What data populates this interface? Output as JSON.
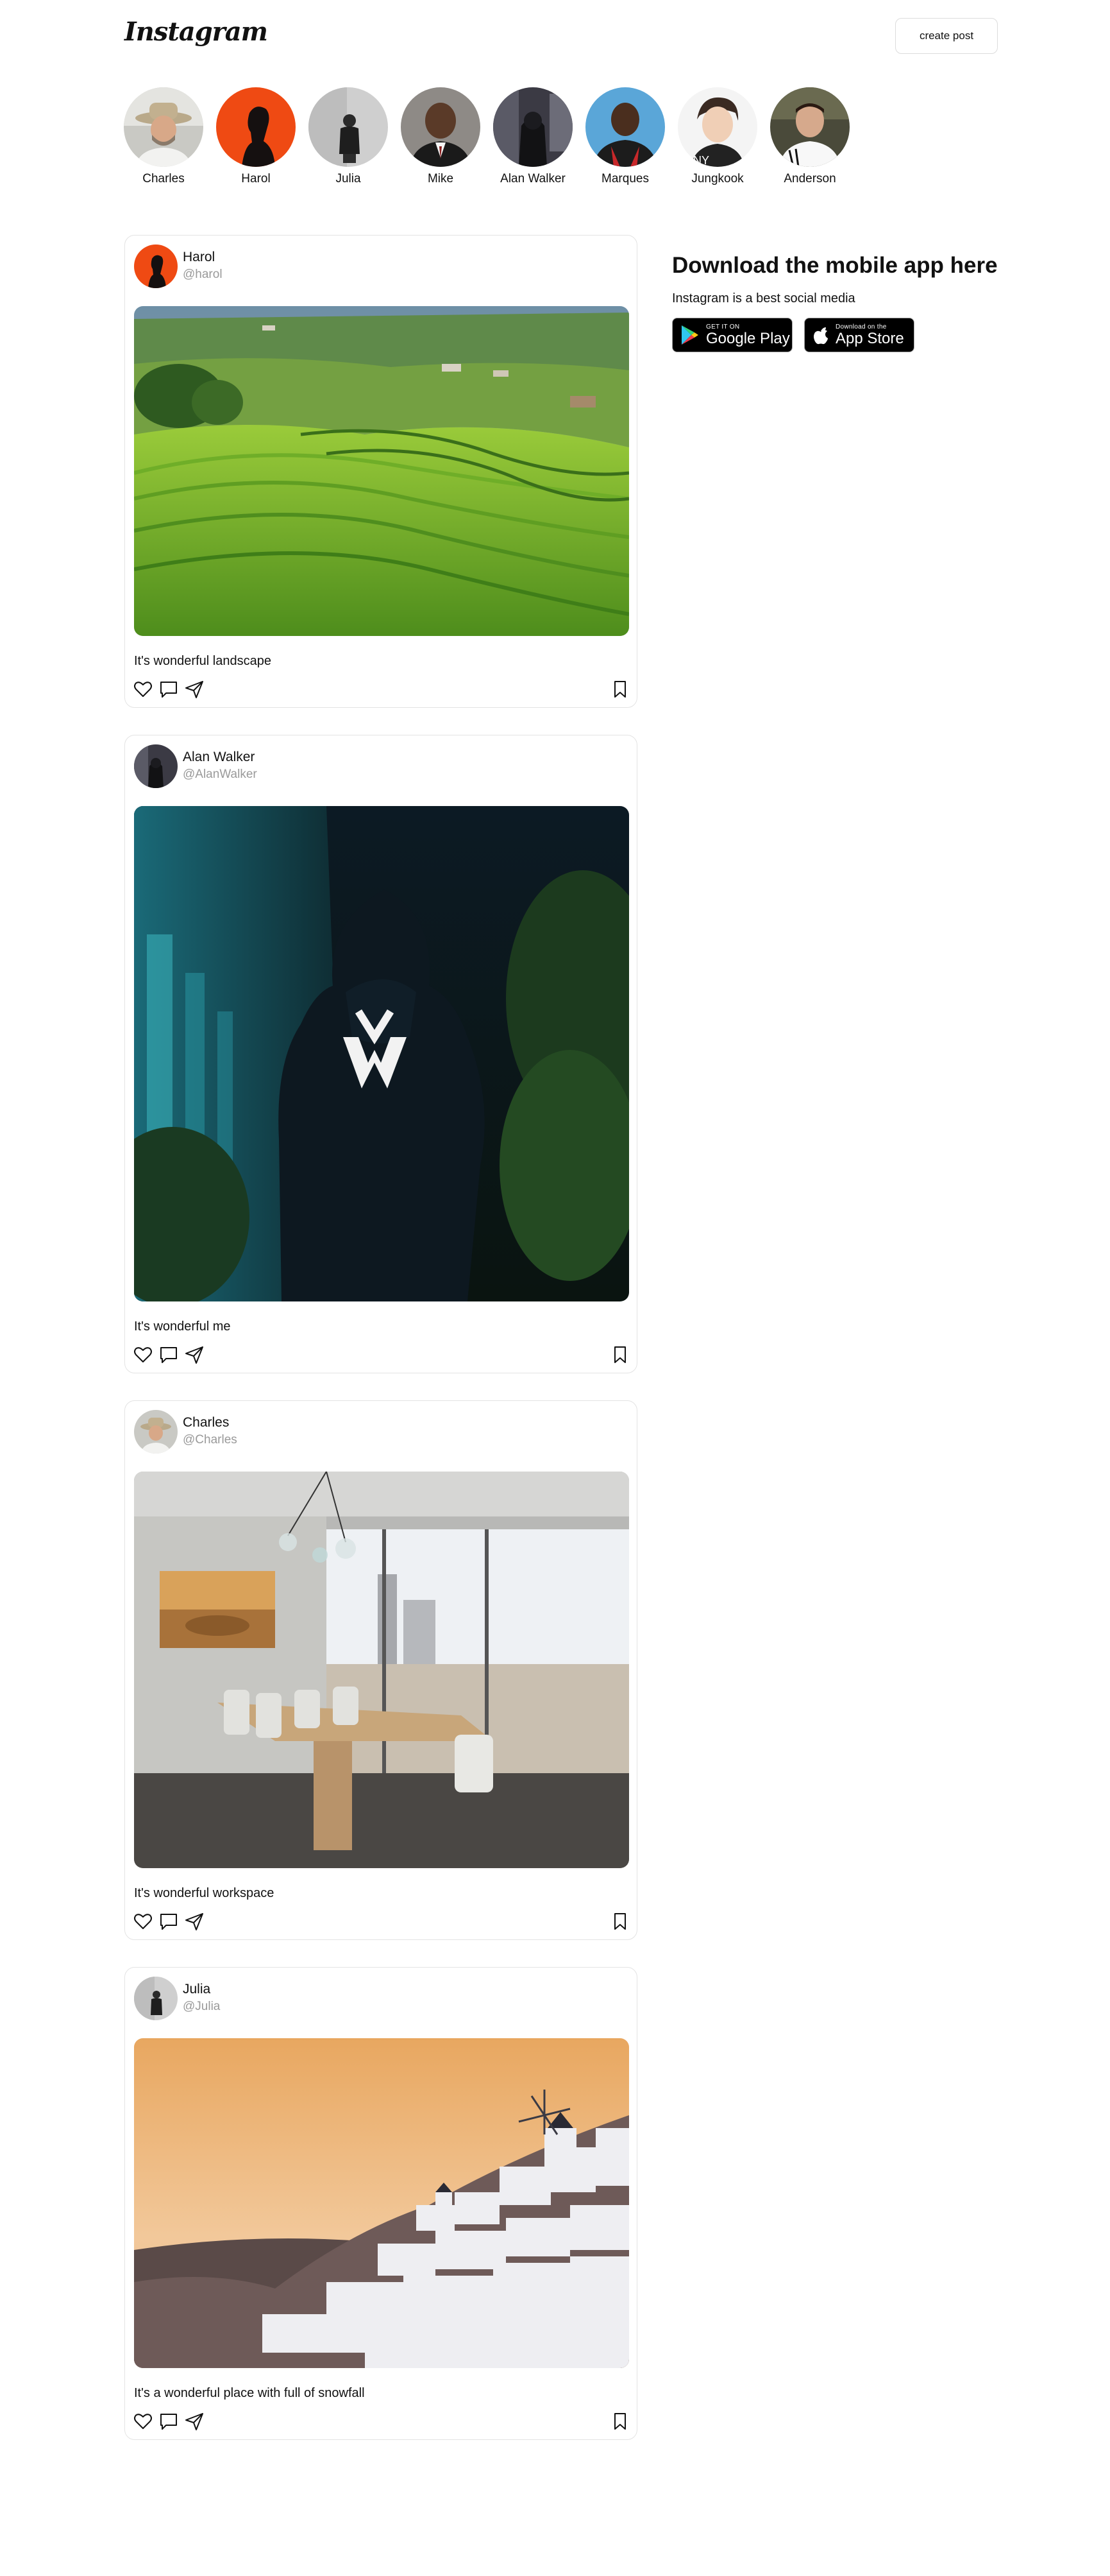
{
  "header": {
    "logo_text": "Instagram",
    "create_post_label": "create post"
  },
  "stories": [
    {
      "name": "Charles"
    },
    {
      "name": "Harol"
    },
    {
      "name": "Julia"
    },
    {
      "name": "Mike"
    },
    {
      "name": "Alan Walker"
    },
    {
      "name": "Marques"
    },
    {
      "name": "Jungkook"
    },
    {
      "name": "Anderson"
    }
  ],
  "posts": [
    {
      "user": "Harol",
      "handle": "@harol",
      "caption": "It's wonderful landscape",
      "image": "rice-terrace-landscape"
    },
    {
      "user": "Alan Walker",
      "handle": "@AlanWalker",
      "caption": "It's wonderful me",
      "image": "hooded-figure-forest"
    },
    {
      "user": "Charles",
      "handle": "@Charles",
      "caption": "It's wonderful workspace",
      "image": "conference-room"
    },
    {
      "user": "Julia",
      "handle": "@Julia",
      "caption": "It's a wonderful place with full of snowfall",
      "image": "santorini-sunset"
    }
  ],
  "sidebar": {
    "title": "Download the mobile app here",
    "subtitle": "Instagram is a best social media",
    "google_play": {
      "small": "GET IT ON",
      "big": "Google Play"
    },
    "app_store": {
      "small": "Download on the",
      "big": "App Store"
    }
  },
  "icons": [
    "heart-icon",
    "comment-icon",
    "share-icon",
    "bookmark-icon",
    "google-play-icon",
    "apple-icon"
  ]
}
